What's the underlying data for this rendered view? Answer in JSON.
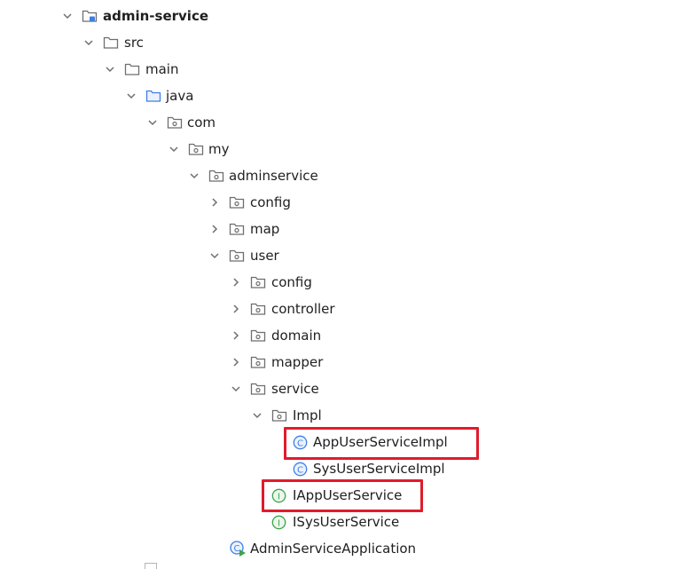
{
  "tree": {
    "root": {
      "label": "admin-service"
    },
    "src": {
      "label": "src"
    },
    "main": {
      "label": "main"
    },
    "java": {
      "label": "java"
    },
    "com": {
      "label": "com"
    },
    "my": {
      "label": "my"
    },
    "adminservice": {
      "label": "adminservice"
    },
    "config": {
      "label": "config"
    },
    "map": {
      "label": "map"
    },
    "user": {
      "label": "user"
    },
    "user_config": {
      "label": "config"
    },
    "controller": {
      "label": "controller"
    },
    "domain": {
      "label": "domain"
    },
    "mapper": {
      "label": "mapper"
    },
    "service": {
      "label": "service"
    },
    "impl": {
      "label": "Impl"
    },
    "app_user_service_impl": {
      "label": "AppUserServiceImpl"
    },
    "sys_user_service_impl": {
      "label": "SysUserServiceImpl"
    },
    "i_app_user_service": {
      "label": "IAppUserService"
    },
    "i_sys_user_service": {
      "label": "ISysUserService"
    },
    "admin_service_application": {
      "label": "AdminServiceApplication"
    }
  },
  "colors": {
    "highlight": "#e01b2b",
    "class_icon": "#3d7ee6",
    "interface_icon": "#3ea34a",
    "folder_stroke": "#6e6e6e",
    "source_folder": "#3d7ee6"
  }
}
